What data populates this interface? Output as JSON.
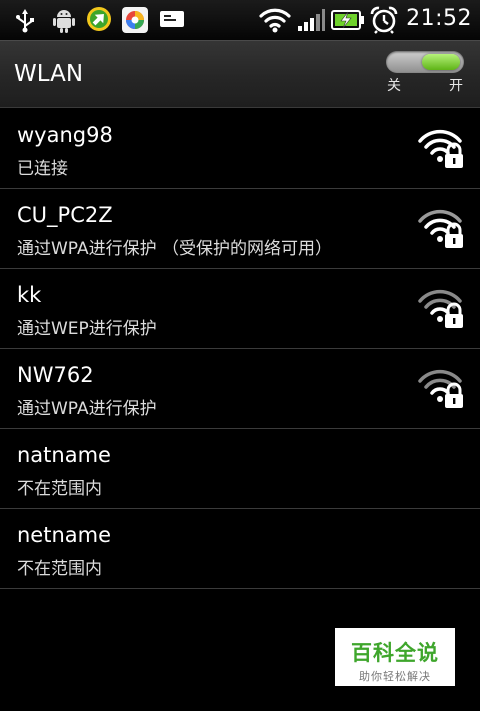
{
  "status_bar": {
    "time": "21:52",
    "icons": [
      "usb-icon",
      "android-debug-icon",
      "download-app-icon",
      "gallery-app-icon",
      "message-icon",
      "wifi-signal-icon",
      "cell-signal-icon",
      "battery-charging-icon",
      "alarm-clock-icon"
    ]
  },
  "header": {
    "title": "WLAN",
    "toggle": {
      "state": "on",
      "off_label": "关",
      "on_label": "开"
    }
  },
  "networks": [
    {
      "ssid": "wyang98",
      "status": "已连接",
      "signal_icon": "wifi-lock-icon",
      "secured": true
    },
    {
      "ssid": "CU_PC2Z",
      "status": "通过WPA进行保护 （受保护的网络可用）",
      "signal_icon": "wifi-lock-icon",
      "secured": true
    },
    {
      "ssid": "kk",
      "status": "通过WEP进行保护",
      "signal_icon": "wifi-lock-icon",
      "secured": true
    },
    {
      "ssid": "NW762",
      "status": "通过WPA进行保护",
      "signal_icon": "wifi-lock-icon",
      "secured": true
    },
    {
      "ssid": "natname",
      "status": "不在范围内",
      "signal_icon": null,
      "secured": false
    },
    {
      "ssid": "netname",
      "status": "不在范围内",
      "signal_icon": null,
      "secured": false
    }
  ],
  "watermark": {
    "title": "百科全说",
    "subtitle": "助你轻松解决"
  },
  "colors": {
    "background": "#000000",
    "divider": "#3b3b3b",
    "toggle_on": "#7ad33a",
    "watermark_green": "#3fa62c"
  }
}
